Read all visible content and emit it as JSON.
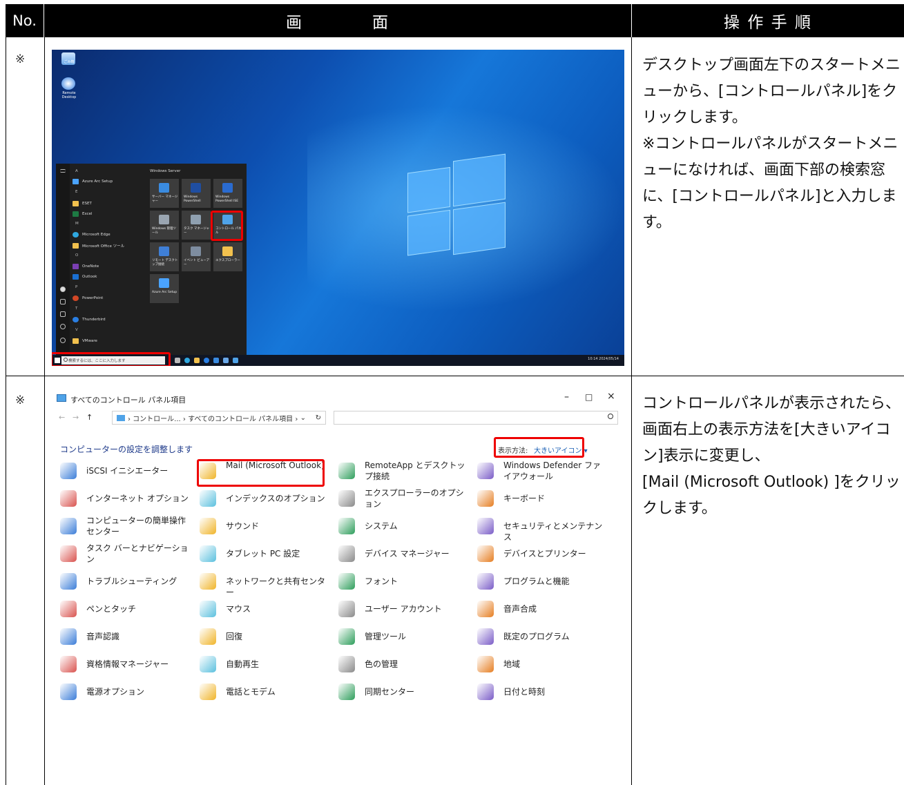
{
  "header": {
    "no": "No.",
    "screen": "画　　　　面",
    "steps": "操 作 手 順"
  },
  "rows": [
    {
      "mark": "※",
      "instruction": "デスクトップ画面左下のスタートメニューから、[コントロールパネル]をクリックします。\n※コントロールパネルがスタートメニューになければ、画面下部の検索窓に、[コントロールパネル]と入力します。"
    },
    {
      "mark": "※",
      "instruction": "コントロールパネルが表示されたら、画面右上の表示方法を[大きいアイコン]表示に変更し、\n[Mail (Microsoft Outlook) ]をクリックします。"
    }
  ],
  "desktop": {
    "icons": [
      {
        "label": "ごみ箱"
      },
      {
        "label": "Remote Desktop"
      }
    ],
    "start_menu": {
      "letters": [
        "A",
        "E",
        "M",
        "O",
        "P",
        "T",
        "V"
      ],
      "apps": [
        "Azure Arc Setup",
        "ESET",
        "Excel",
        "Microsoft Edge",
        "Microsoft Office ツール",
        "OneNote",
        "Outlook",
        "PowerPoint",
        "Thunderbird",
        "VMware"
      ],
      "group": "Windows Server",
      "tiles": [
        "サーバー マネージャー",
        "Windows PowerShell",
        "Windows PowerShell ISE",
        "Windows 管理ツール",
        "タスク マネージャー",
        "コントロール パネル",
        "リモート デスクトップ接続",
        "イベント ビューアー",
        "エクスプローラー",
        "Azure Arc Setup"
      ]
    },
    "search_placeholder": "検索するには、ここに入力します",
    "tray_time": "10:14",
    "tray_date": "2024/05/14"
  },
  "control_panel": {
    "window_title": "すべてのコントロール パネル項目",
    "breadcrumb": "› コントロール... › すべてのコントロール パネル項目 ›",
    "heading": "コンピューターの設定を調整します",
    "view_label": "表示方法:",
    "view_value": "大きいアイコン ▾",
    "items": [
      [
        "iSCSI イニシエーター",
        "Mail (Microsoft Outlook)",
        "RemoteApp とデスクトップ接続",
        "Windows Defender ファイアウォール"
      ],
      [
        "インターネット オプション",
        "インデックスのオプション",
        "エクスプローラーのオプション",
        "キーボード"
      ],
      [
        "コンピューターの簡単操作センター",
        "サウンド",
        "システム",
        "セキュリティとメンテナンス"
      ],
      [
        "タスク バーとナビゲーション",
        "タブレット PC 設定",
        "デバイス マネージャー",
        "デバイスとプリンター"
      ],
      [
        "トラブルシューティング",
        "ネットワークと共有センター",
        "フォント",
        "プログラムと機能"
      ],
      [
        "ペンとタッチ",
        "マウス",
        "ユーザー アカウント",
        "音声合成"
      ],
      [
        "音声認識",
        "回復",
        "管理ツール",
        "既定のプログラム"
      ],
      [
        "資格情報マネージャー",
        "自動再生",
        "色の管理",
        "地域"
      ],
      [
        "電源オプション",
        "電話とモデム",
        "同期センター",
        "日付と時刻"
      ]
    ],
    "icon_colors": [
      "#3b7dd8",
      "#f0b429",
      "#2e9e5b",
      "#7a5cc7",
      "#d9534f",
      "#5bc0de",
      "#8a8a8a",
      "#e67e22"
    ]
  },
  "highlight_color": "#e00000"
}
